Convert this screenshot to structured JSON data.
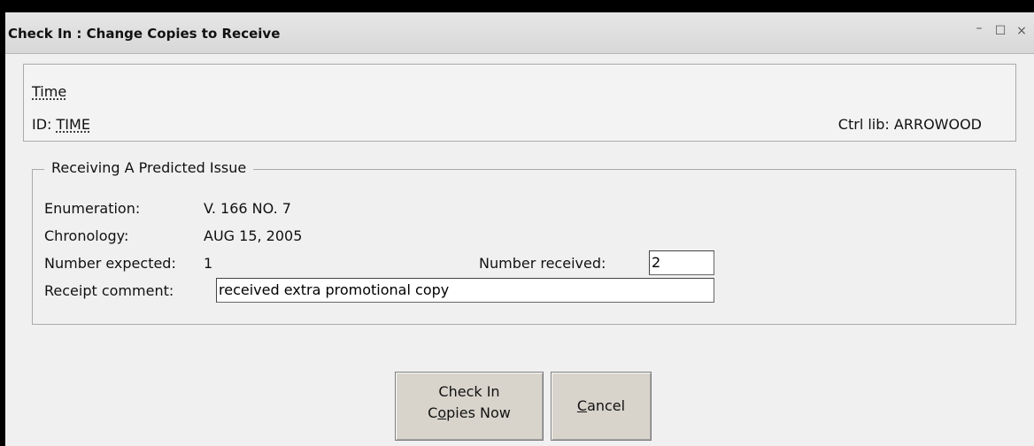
{
  "window": {
    "title": "Check In : Change Copies to Receive",
    "controls": {
      "minimize": "–",
      "maximize": "☐",
      "close": "×"
    }
  },
  "info": {
    "title_link": "Time",
    "id_label": "ID:",
    "id_value": "TIME",
    "ctrl_lib_label": "Ctrl lib:",
    "ctrl_lib_value": "ARROWOOD"
  },
  "receiving": {
    "legend": "Receiving A Predicted Issue",
    "enumeration_label": "Enumeration:",
    "enumeration_value": "V. 166 NO. 7",
    "chronology_label": "Chronology:",
    "chronology_value": "AUG 15, 2005",
    "number_expected_label": "Number expected:",
    "number_expected_value": "1",
    "number_received_label": "Number received:",
    "number_received_value": "2",
    "receipt_comment_label": "Receipt comment:",
    "receipt_comment_value": "received extra promotional copy"
  },
  "buttons": {
    "checkin_line1": "Check In",
    "checkin_line2_pre": "C",
    "checkin_line2_mnemonic": "o",
    "checkin_line2_post": "pies Now",
    "cancel_mnemonic": "C",
    "cancel_rest": "ancel"
  }
}
